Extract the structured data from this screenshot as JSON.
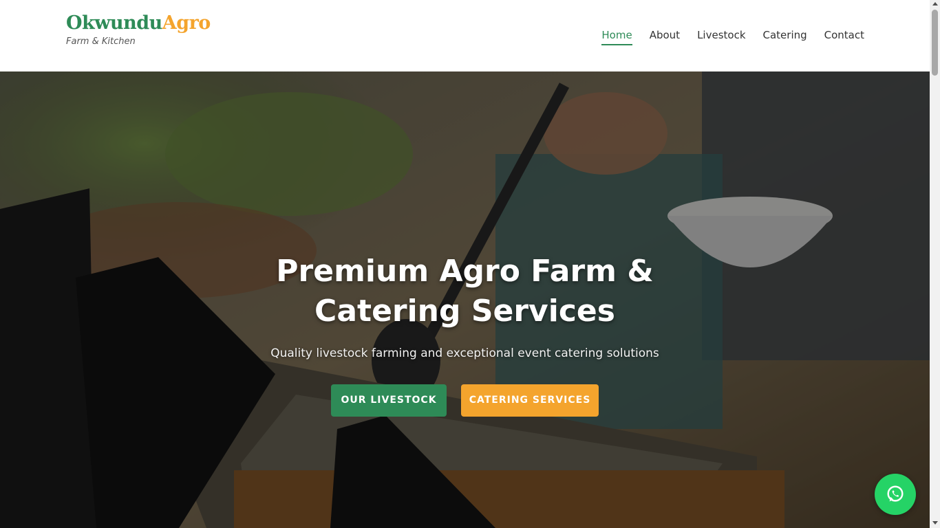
{
  "brand": {
    "name_part1": "Okwundu",
    "name_part2": "Agro",
    "tagline": "Farm & Kitchen",
    "color_primary": "#2e8b57",
    "color_accent": "#f4a42d"
  },
  "nav": {
    "items": [
      {
        "label": "Home",
        "active": true
      },
      {
        "label": "About",
        "active": false
      },
      {
        "label": "Livestock",
        "active": false
      },
      {
        "label": "Catering",
        "active": false
      },
      {
        "label": "Contact",
        "active": false
      }
    ]
  },
  "hero": {
    "title": "Premium Agro Farm & Catering Services",
    "subtitle": "Quality livestock farming and exceptional event catering solutions",
    "background": "catering buffet photo with serving ladle and bowl",
    "buttons": {
      "primary_label": "OUR LIVESTOCK",
      "secondary_label": "CATERING SERVICES"
    }
  },
  "floating": {
    "whatsapp_icon": "whatsapp-icon",
    "whatsapp_color": "#25d366"
  }
}
